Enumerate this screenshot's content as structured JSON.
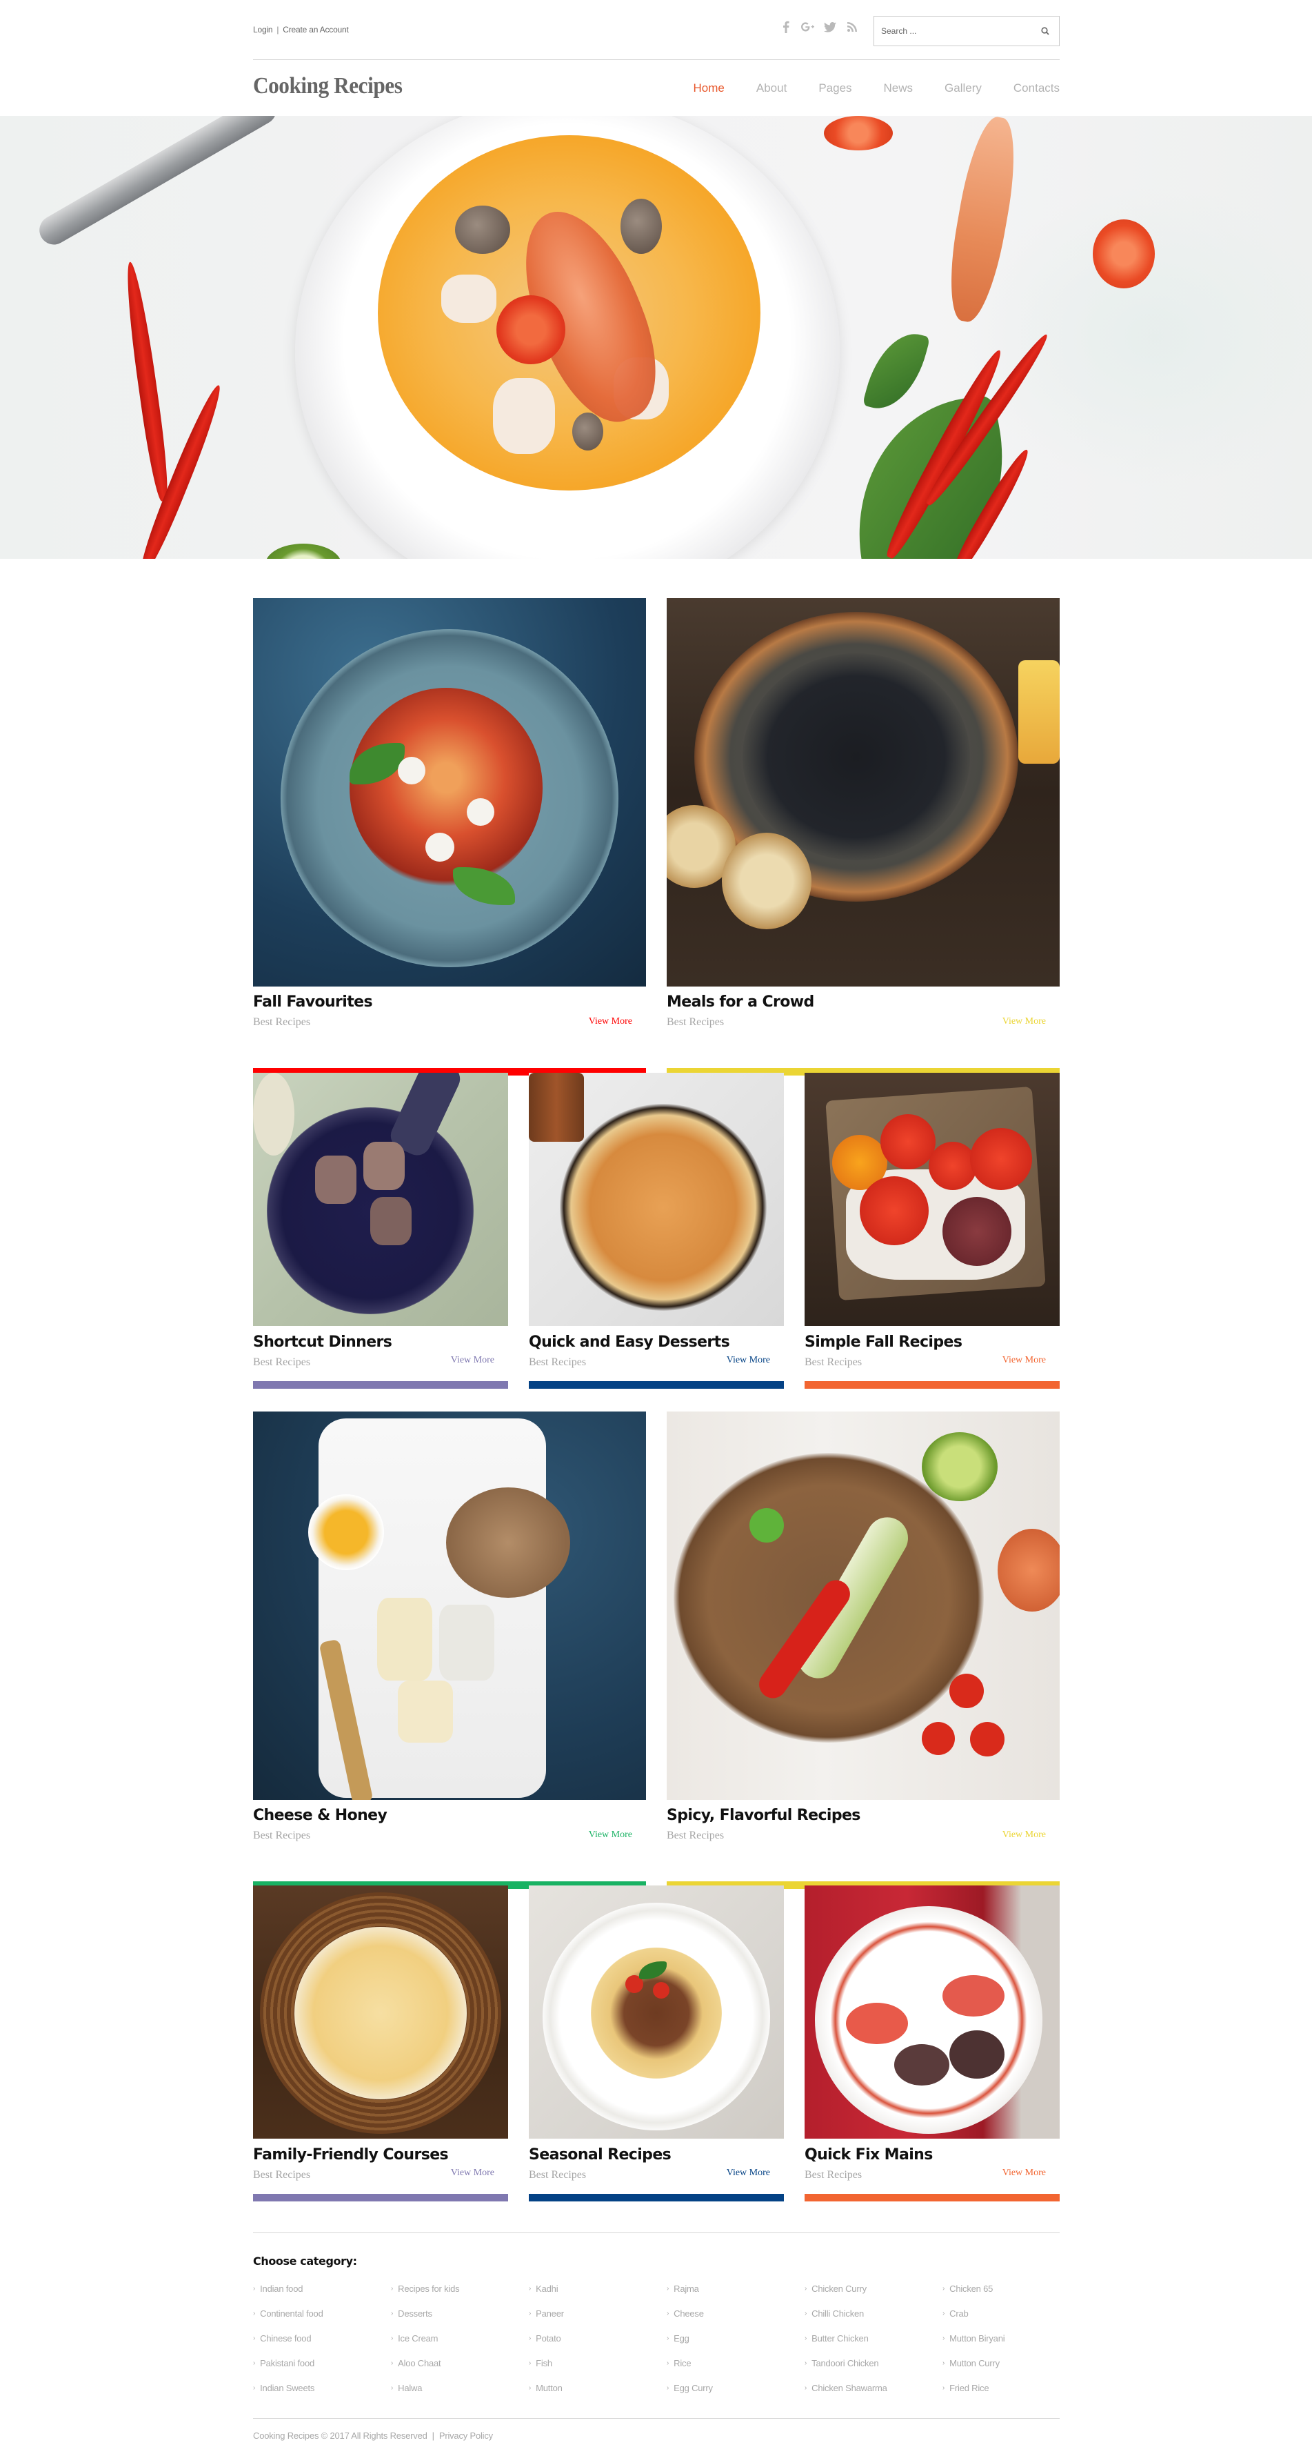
{
  "topbar": {
    "login": "Login",
    "separator": "|",
    "create_account": "Create an Account",
    "social": [
      {
        "name": "facebook-icon",
        "glyph": "f"
      },
      {
        "name": "google-plus-icon",
        "glyph": "G+"
      },
      {
        "name": "twitter-icon",
        "glyph": "twitter"
      },
      {
        "name": "rss-icon",
        "glyph": "rss"
      }
    ],
    "search_placeholder": "Search ...",
    "search_icon": "search-icon"
  },
  "header": {
    "logo": "Cooking Recipes",
    "nav": [
      {
        "label": "Home",
        "active": true
      },
      {
        "label": "About",
        "active": false
      },
      {
        "label": "Pages",
        "active": false
      },
      {
        "label": "News",
        "active": false
      },
      {
        "label": "Gallery",
        "active": false
      },
      {
        "label": "Contacts",
        "active": false
      }
    ],
    "accent_color": "#e8582c"
  },
  "hero": {
    "image": "seafood-soup-hero"
  },
  "cards": [
    {
      "title": "Fall Favourites",
      "subtitle": "Best Recipes",
      "link": "View More",
      "color": "#ff0000",
      "image": "tomato-salad-blue-plate"
    },
    {
      "title": "Meals for a Crowd",
      "subtitle": "Best Recipes",
      "link": "View More",
      "color": "#ebd534",
      "image": "mussels-pan"
    },
    {
      "title": "Shortcut Dinners",
      "subtitle": "Best Recipes",
      "link": "View More",
      "color": "#7f78b0",
      "image": "artichoke-skillet"
    },
    {
      "title": "Quick and Easy Desserts",
      "subtitle": "Best Recipes",
      "link": "View More",
      "color": "#044285",
      "image": "apricot-tart"
    },
    {
      "title": "Simple Fall Recipes",
      "subtitle": "Best Recipes",
      "link": "View More",
      "color": "#f26531",
      "image": "tomatoes-crate"
    },
    {
      "title": "Cheese & Honey",
      "subtitle": "Best Recipes",
      "link": "View More",
      "color": "#19b263",
      "image": "cheese-board-honey"
    },
    {
      "title": "Spicy, Flavorful Recipes",
      "subtitle": "Best Recipes",
      "link": "View More",
      "color": "#ebd534",
      "image": "vegetables-bowl"
    },
    {
      "title": "Family-Friendly Courses",
      "subtitle": "Best Recipes",
      "link": "View More",
      "color": "#7f78b0",
      "image": "penne-pasta"
    },
    {
      "title": "Seasonal Recipes",
      "subtitle": "Best Recipes",
      "link": "View More",
      "color": "#044285",
      "image": "spaghetti-bolognese"
    },
    {
      "title": "Quick Fix Mains",
      "subtitle": "Best Recipes",
      "link": "View More",
      "color": "#f26531",
      "image": "grilled-eggplant-plate"
    }
  ],
  "footer": {
    "category_title": "Choose category:",
    "categories": [
      [
        "Indian food",
        "Continental food",
        "Chinese food",
        "Pakistani food",
        "Indian Sweets"
      ],
      [
        "Recipes for kids",
        "Desserts",
        "Ice Cream",
        "Aloo Chaat",
        "Halwa"
      ],
      [
        "Kadhi",
        "Paneer",
        "Potato",
        "Fish",
        "Mutton"
      ],
      [
        "Rajma",
        "Cheese",
        "Egg",
        "Rice",
        "Egg Curry"
      ],
      [
        "Chicken Curry",
        "Chilli Chicken",
        "Butter Chicken",
        "Tandoori Chicken",
        "Chicken Shawarma"
      ],
      [
        "Chicken 65",
        "Crab",
        "Mutton Biryani",
        "Mutton Curry",
        "Fried Rice"
      ]
    ],
    "copyright": "Cooking Recipes © 2017 All Rights Reserved",
    "separator": "|",
    "privacy": "Privacy Policy"
  }
}
